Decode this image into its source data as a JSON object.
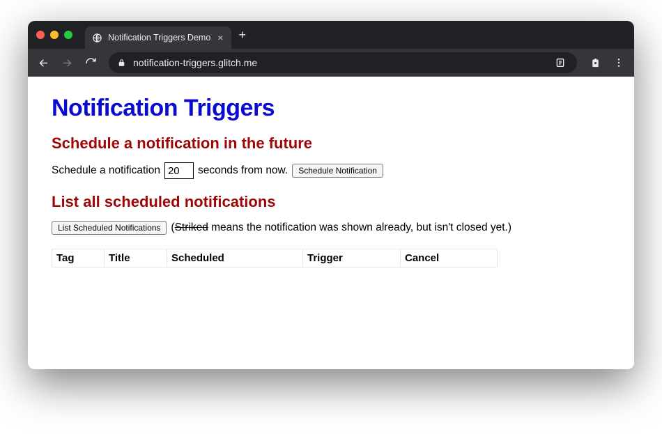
{
  "browser": {
    "tab_title": "Notification Triggers Demo",
    "url": "notification-triggers.glitch.me"
  },
  "page": {
    "title": "Notification Triggers",
    "schedule_section": {
      "heading": "Schedule a notification in the future",
      "prefix_text": "Schedule a notification",
      "seconds_value": "20",
      "suffix_text": "seconds from now.",
      "button_label": "Schedule Notification"
    },
    "list_section": {
      "heading": "List all scheduled notifications",
      "button_label": "List Scheduled Notifications",
      "note_open": "(",
      "note_striked": "Striked",
      "note_rest": " means the notification was shown already, but isn't closed yet.)",
      "columns": {
        "tag": "Tag",
        "title": "Title",
        "scheduled": "Scheduled",
        "trigger": "Trigger",
        "cancel": "Cancel"
      }
    }
  }
}
